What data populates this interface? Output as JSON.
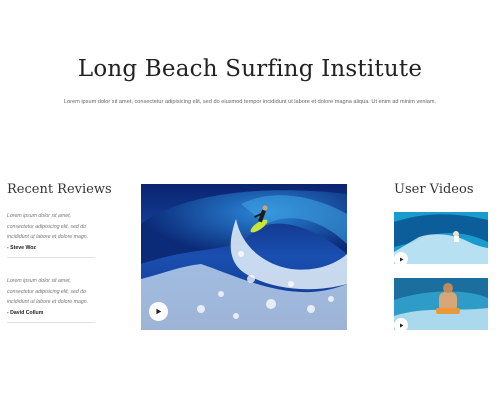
{
  "header": {
    "title": "Long Beach Surfing Institute",
    "tagline": "Lorem ipsum dolor sit amet, consectetur adipisicing elit, sed do eiusmod tempor incididunt ut labore et dolore magna aliqua. Ut enim ad minim veniam."
  },
  "reviews": {
    "heading": "Recent Reviews",
    "items": [
      {
        "lines": [
          "Lorem ipsum dolor sit amet,",
          "consectetur adipisicing elit, sed do",
          "incididunt ut labore et dolore magn."
        ],
        "author": "- Steve Woz"
      },
      {
        "lines": [
          "Lorem ipsum dolor sit amet,",
          "consectetur adipisicing elit, sed do",
          "incididunt ut labore et dolore magn."
        ],
        "author": "- David Collum"
      }
    ]
  },
  "main_video": {
    "icon": "play-icon"
  },
  "user_videos": {
    "heading": "User Videos",
    "items": [
      {
        "icon": "play-icon"
      },
      {
        "icon": "play-icon"
      }
    ]
  },
  "colors": {
    "wave_deep": "#0b2a78",
    "wave_mid": "#1f5fb8",
    "foam": "#e8f3fb",
    "sky_blue": "#1a9bd0",
    "surfboard": "#c8e63a"
  }
}
